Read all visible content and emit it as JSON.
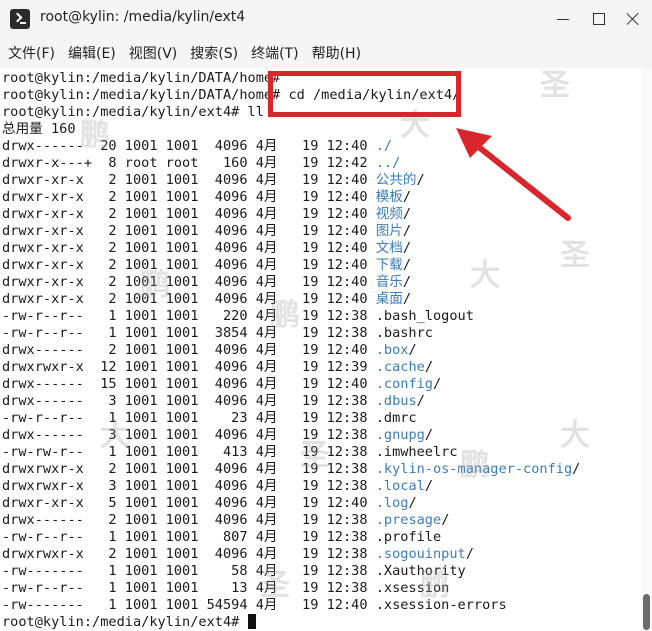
{
  "window": {
    "title": "root@kylin: /media/kylin/ext4"
  },
  "menu": [
    "文件(F)",
    "编辑(E)",
    "视图(V)",
    "搜索(S)",
    "终端(T)",
    "帮助(H)"
  ],
  "terminal": {
    "lines": [
      {
        "text": "root@kylin:/media/kylin/DATA/home#"
      },
      {
        "text": "root@kylin:/media/kylin/DATA/home# cd /media/kylin/ext4/"
      },
      {
        "text": "root@kylin:/media/kylin/ext4# ll"
      },
      {
        "text": "总用量 160"
      },
      {
        "text": "drwx------  20 1001 1001  4096 4月   19 12:40 ",
        "name": "./",
        "dir": true
      },
      {
        "text": "drwxr-x---+  8 root root   160 4月   19 12:42 ",
        "name": "../",
        "dir": true
      },
      {
        "text": "drwxr-xr-x   2 1001 1001  4096 4月   19 12:40 ",
        "name": "公共的",
        "suffix": "/",
        "dir": true,
        "cjk": true
      },
      {
        "text": "drwxr-xr-x   2 1001 1001  4096 4月   19 12:40 ",
        "name": "模板",
        "suffix": "/",
        "dir": true,
        "cjk": true
      },
      {
        "text": "drwxr-xr-x   2 1001 1001  4096 4月   19 12:40 ",
        "name": "视频",
        "suffix": "/",
        "dir": true,
        "cjk": true
      },
      {
        "text": "drwxr-xr-x   2 1001 1001  4096 4月   19 12:40 ",
        "name": "图片",
        "suffix": "/",
        "dir": true,
        "cjk": true
      },
      {
        "text": "drwxr-xr-x   2 1001 1001  4096 4月   19 12:40 ",
        "name": "文档",
        "suffix": "/",
        "dir": true,
        "cjk": true
      },
      {
        "text": "drwxr-xr-x   2 1001 1001  4096 4月   19 12:40 ",
        "name": "下载",
        "suffix": "/",
        "dir": true,
        "cjk": true
      },
      {
        "text": "drwxr-xr-x   2 1001 1001  4096 4月   19 12:40 ",
        "name": "音乐",
        "suffix": "/",
        "dir": true,
        "cjk": true
      },
      {
        "text": "drwxr-xr-x   2 1001 1001  4096 4月   19 12:40 ",
        "name": "桌面",
        "suffix": "/",
        "dir": true,
        "cjk": true
      },
      {
        "text": "-rw-r--r--   1 1001 1001   220 4月   19 12:38 .bash_logout"
      },
      {
        "text": "-rw-r--r--   1 1001 1001  3854 4月   19 12:38 .bashrc"
      },
      {
        "text": "drwx------   2 1001 1001  4096 4月   19 12:40 ",
        "name": ".box",
        "suffix": "/",
        "dir": true
      },
      {
        "text": "drwxrwxr-x  12 1001 1001  4096 4月   19 12:39 ",
        "name": ".cache",
        "suffix": "/",
        "dir": true
      },
      {
        "text": "drwx------  15 1001 1001  4096 4月   19 12:40 ",
        "name": ".config",
        "suffix": "/",
        "dir": true
      },
      {
        "text": "drwx------   3 1001 1001  4096 4月   19 12:38 ",
        "name": ".dbus",
        "suffix": "/",
        "dir": true
      },
      {
        "text": "-rw-r--r--   1 1001 1001    23 4月   19 12:38 .dmrc"
      },
      {
        "text": "drwx------   3 1001 1001  4096 4月   19 12:38 ",
        "name": ".gnupg",
        "suffix": "/",
        "dir": true
      },
      {
        "text": "-rw-rw-r--   1 1001 1001   413 4月   19 12:38 .imwheelrc"
      },
      {
        "text": "drwxrwxr-x   2 1001 1001  4096 4月   19 12:38 ",
        "name": ".kylin-os-manager-config",
        "suffix": "/",
        "dir": true
      },
      {
        "text": "drwxrwxr-x   3 1001 1001  4096 4月   19 12:38 ",
        "name": ".local",
        "suffix": "/",
        "dir": true
      },
      {
        "text": "drwxr-xr-x   5 1001 1001  4096 4月   19 12:40 ",
        "name": ".log",
        "suffix": "/",
        "dir": true
      },
      {
        "text": "drwx------   2 1001 1001  4096 4月   19 12:38 ",
        "name": ".presage",
        "suffix": "/",
        "dir": true
      },
      {
        "text": "-rw-r--r--   1 1001 1001   807 4月   19 12:38 .profile"
      },
      {
        "text": "drwxrwxr-x   2 1001 1001  4096 4月   19 12:38 ",
        "name": ".sogouinput",
        "suffix": "/",
        "dir": true
      },
      {
        "text": "-rw-------   1 1001 1001    58 4月   19 12:38 .Xauthority"
      },
      {
        "text": "-rw-r--r--   1 1001 1001    13 4月   19 12:38 .xsession"
      },
      {
        "text": "-rw-------   1 1001 1001 54594 4月   19 12:40 .xsession-errors"
      },
      {
        "text": "root@kylin:/media/kylin/ext4# ",
        "cursor": true
      }
    ]
  },
  "watermark": [
    "鹏",
    "大",
    "圣"
  ],
  "colors": {
    "directory": "#3a7dbd",
    "annotation": "#d8262c",
    "text": "#1a1a1a"
  }
}
